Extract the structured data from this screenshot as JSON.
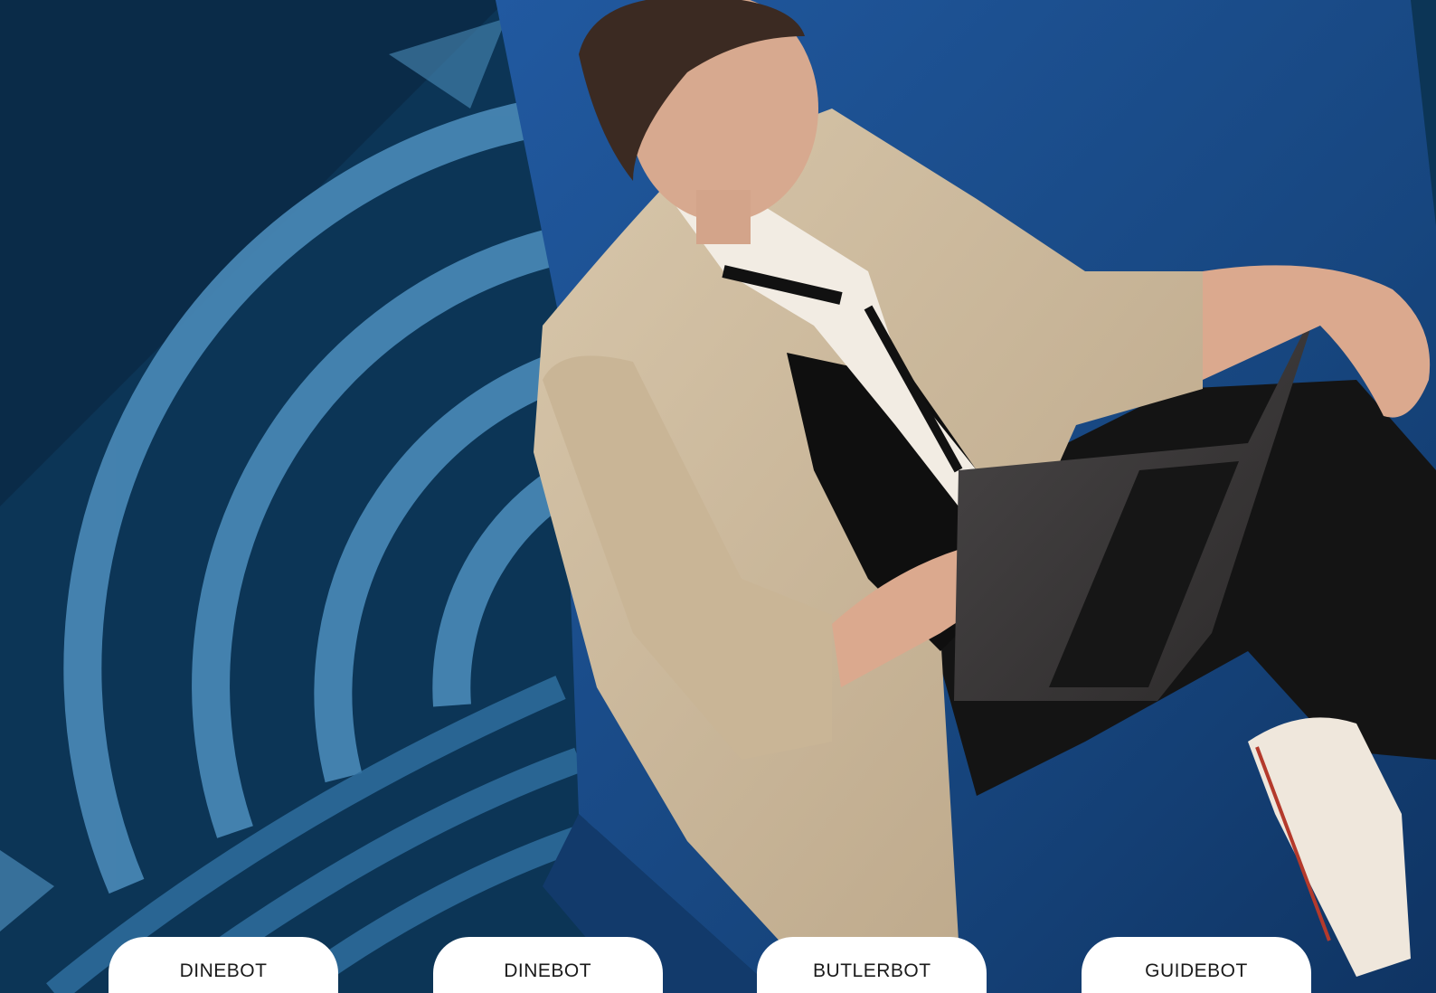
{
  "hero": {
    "image_alt": "Woman in a beige blazer working on a laptop while seated in a blue chair over a patterned blue carpet"
  },
  "products": [
    {
      "label": "DINEBOT"
    },
    {
      "label": "DINEBOT"
    },
    {
      "label": "BUTLERBOT"
    },
    {
      "label": "GUIDEBOT"
    }
  ],
  "colors": {
    "carpet_dark": "#0c3556",
    "carpet_light": "#4a8ab8",
    "chair_blue": "#1c4f8f",
    "blazer": "#cbb89c",
    "pill_bg": "#ffffff"
  }
}
